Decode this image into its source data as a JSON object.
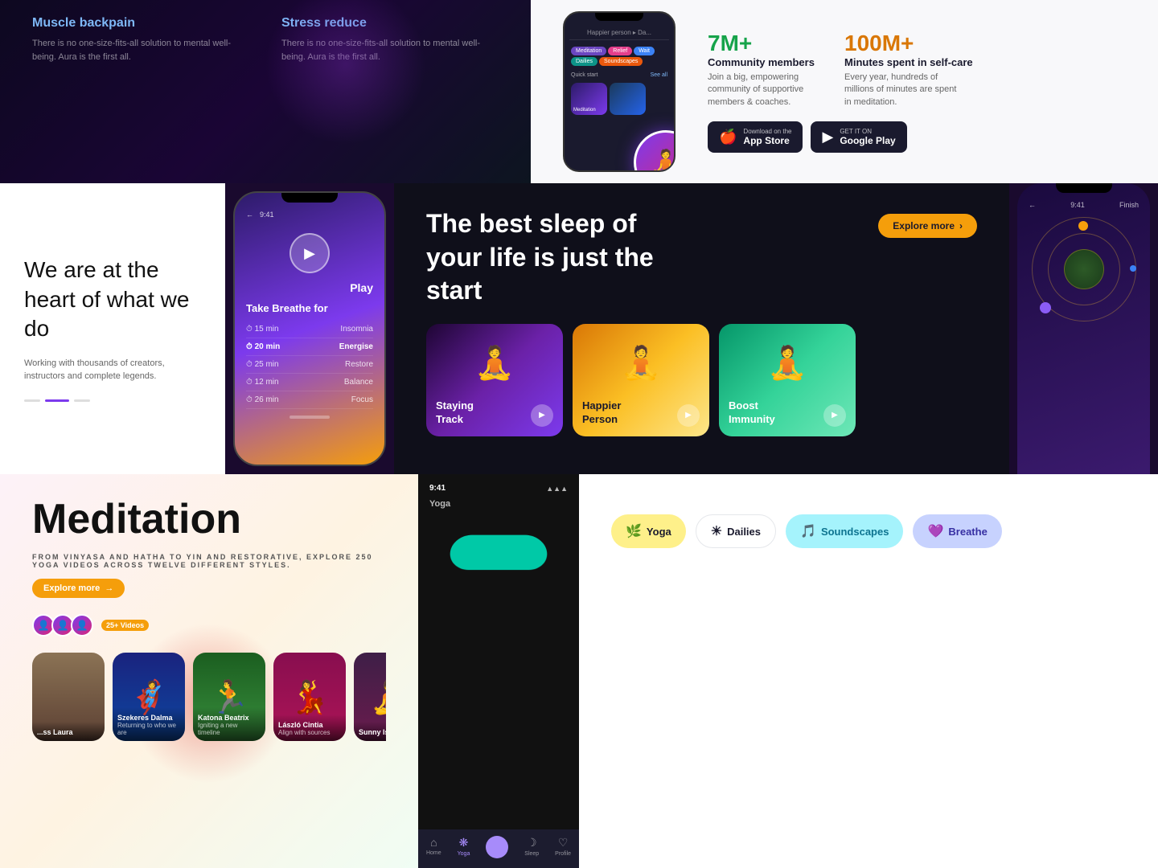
{
  "top": {
    "left_cards": [
      {
        "title": "Muscle backpain",
        "desc": "There is no one-size-fits-all solution to mental well-being. Aura is the first all."
      },
      {
        "title": "Stress reduce",
        "desc": "There is no one-size-fits-all solution to mental well-being. Aura is the first all."
      }
    ],
    "stats": [
      {
        "value": "7M+",
        "label": "Community members",
        "desc": "Join a big, empowering community of supportive members & coaches.",
        "color": "green"
      },
      {
        "value": "100M+",
        "label": "Minutes spent in self-care",
        "desc": "Every year, hundreds of millions of minutes are spent in meditation.",
        "color": "amber"
      }
    ],
    "app_store": {
      "label": "Download on the",
      "name": "App Store"
    },
    "google_play": {
      "label": "GET IT ON",
      "name": "Google Play"
    }
  },
  "middle": {
    "left": {
      "headline": "We are at the heart of what we do",
      "desc": "Working with thousands of creators, instructors and complete legends."
    },
    "phone": {
      "time": "9:41",
      "back": "←",
      "play_label": "Play",
      "title": "Take Breathe for",
      "items": [
        {
          "time": "15 min",
          "label": "Insomnia",
          "active": false
        },
        {
          "time": "20 min",
          "label": "Energise",
          "active": false
        },
        {
          "time": "25 min",
          "label": "Restore",
          "active": false
        },
        {
          "time": "12 min",
          "label": "Balance",
          "active": false
        },
        {
          "time": "26 min",
          "label": "Focus",
          "active": false
        }
      ]
    },
    "dark_panel": {
      "headline": "The best sleep of your life is just the start",
      "explore_btn": "Explore more",
      "cards": [
        {
          "id": "staying",
          "label": "Staying\nTrack",
          "theme": "dark"
        },
        {
          "id": "happier",
          "label": "Happier\nPerson",
          "theme": "dark"
        },
        {
          "id": "boost",
          "label": "Boost\nImmunity",
          "theme": "dark"
        }
      ]
    },
    "right_phone": {
      "time": "9:41",
      "back": "←",
      "finish": "Finish"
    }
  },
  "bottom": {
    "meditation": {
      "title": "Meditation",
      "subtitle": "FROM VINYASA AND HATHA TO YIN AND RESTORATIVE, EXPLORE 250 YOGA VIDEOS ACROSS TWELVE DIFFERENT STYLES.",
      "explore_btn": "Explore more",
      "video_count": "25+",
      "video_label": "Videos",
      "creators": [
        {
          "name": "... Laura",
          "role": ""
        },
        {
          "name": "Szekeres Dalma",
          "role": "Returning to who we are"
        },
        {
          "name": "Katona Beatrix",
          "role": "Igniting a new timeline"
        },
        {
          "name": "László Cintia",
          "role": "Align with sources"
        },
        {
          "name": "Sunny Isabella",
          "role": ""
        }
      ]
    },
    "yoga_phone": {
      "time": "9:41",
      "tab": "Yoga",
      "nav_items": [
        {
          "icon": "⌂",
          "label": "Home",
          "active": false
        },
        {
          "icon": "❋",
          "label": "Yoga",
          "active": true
        },
        {
          "icon": "◯",
          "label": "",
          "active": false
        },
        {
          "icon": "☽",
          "label": "Sleep",
          "active": false
        },
        {
          "icon": "♡",
          "label": "Profile",
          "active": false
        }
      ]
    },
    "white_section": {
      "tags": [
        {
          "id": "yoga",
          "icon": "🌿",
          "label": "Yoga",
          "theme": "yoga"
        },
        {
          "id": "dailies",
          "icon": "☀",
          "label": "Dailies",
          "theme": "dailies"
        },
        {
          "id": "soundscapes",
          "icon": "🎵",
          "label": "Soundscapes",
          "theme": "soundscapes"
        },
        {
          "id": "breathe",
          "icon": "💜",
          "label": "Breathe",
          "theme": "breathe"
        }
      ]
    }
  }
}
